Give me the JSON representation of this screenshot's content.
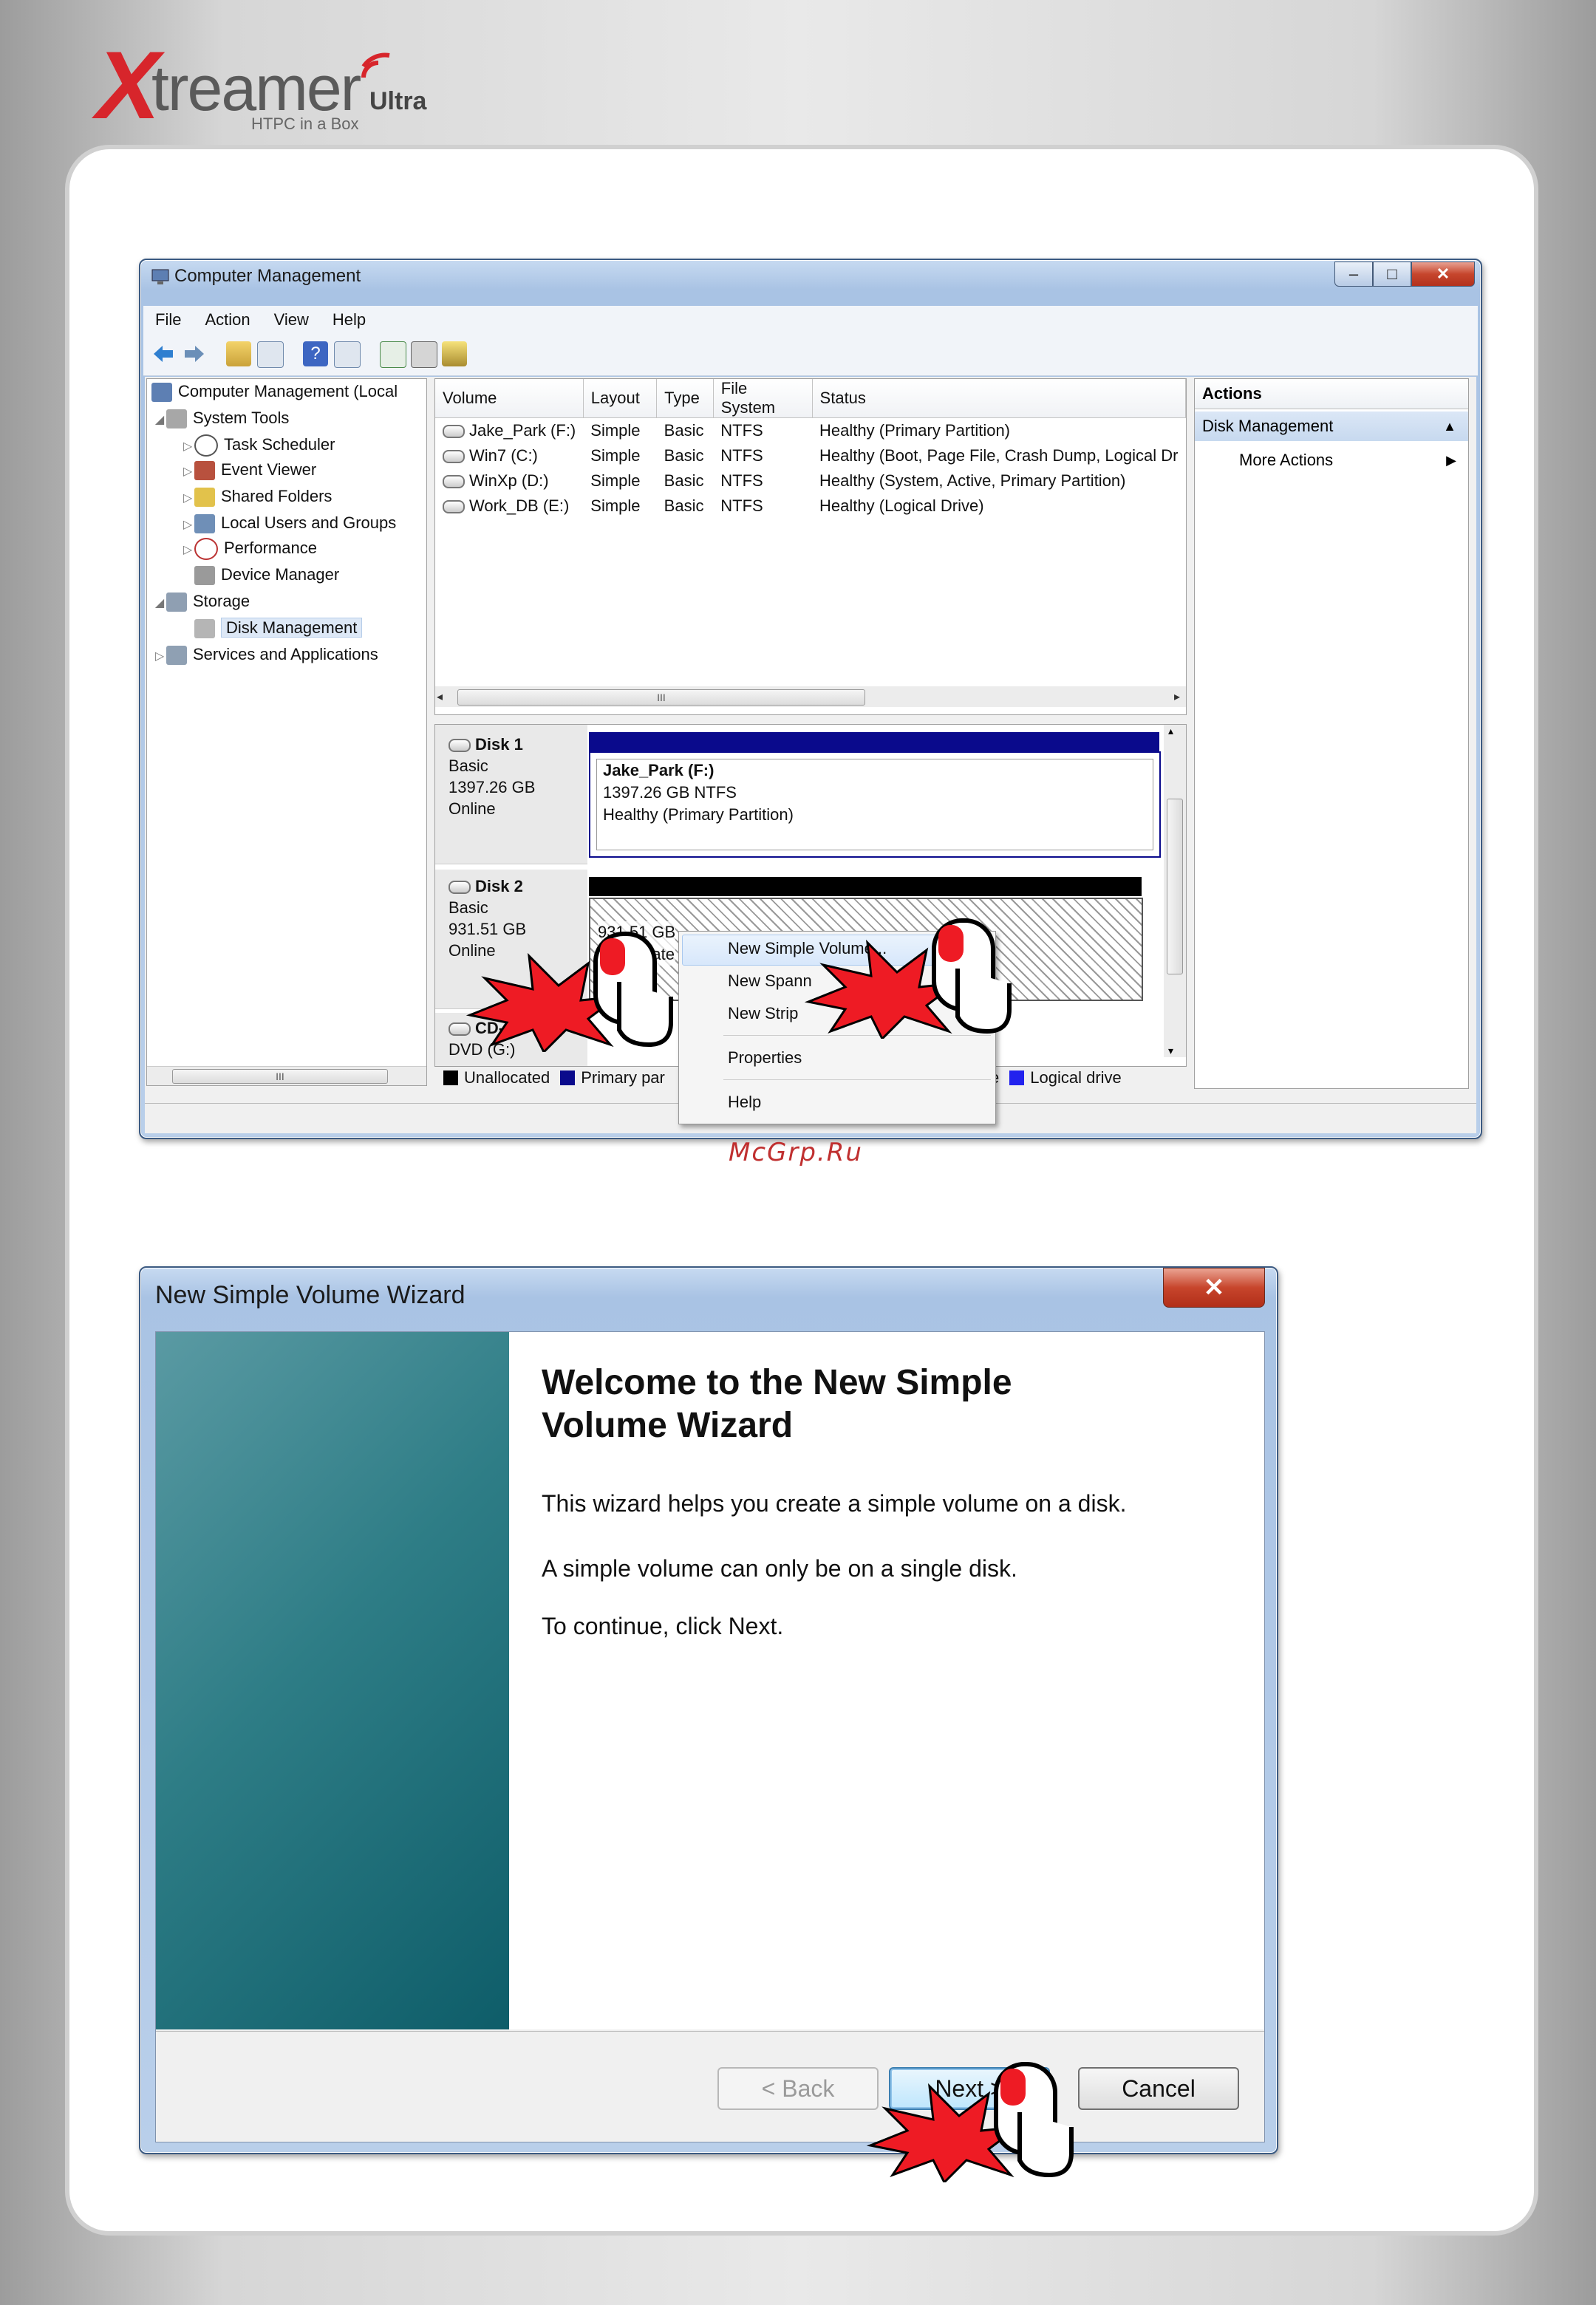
{
  "brand": {
    "mark": "X",
    "word": "treamer",
    "edition": "Ultra",
    "tagline": "HTPC in a Box"
  },
  "watermark": "McGrp.Ru",
  "computer_management": {
    "title": "Computer Management",
    "menu": [
      "File",
      "Action",
      "View",
      "Help"
    ],
    "tree": {
      "root": "Computer Management (Local",
      "system_tools": "System Tools",
      "task_scheduler": "Task Scheduler",
      "event_viewer": "Event Viewer",
      "shared_folders": "Shared Folders",
      "local_users": "Local Users and Groups",
      "performance": "Performance",
      "device_manager": "Device Manager",
      "storage": "Storage",
      "disk_management": "Disk Management",
      "services": "Services and Applications"
    },
    "columns": [
      "Volume",
      "Layout",
      "Type",
      "File System",
      "Status"
    ],
    "volumes": [
      {
        "volume": "Jake_Park (F:)",
        "layout": "Simple",
        "type": "Basic",
        "fs": "NTFS",
        "status": "Healthy (Primary Partition)"
      },
      {
        "volume": "Win7 (C:)",
        "layout": "Simple",
        "type": "Basic",
        "fs": "NTFS",
        "status": "Healthy (Boot, Page File, Crash Dump, Logical Dr"
      },
      {
        "volume": "WinXp (D:)",
        "layout": "Simple",
        "type": "Basic",
        "fs": "NTFS",
        "status": "Healthy (System, Active, Primary Partition)"
      },
      {
        "volume": "Work_DB (E:)",
        "layout": "Simple",
        "type": "Basic",
        "fs": "NTFS",
        "status": "Healthy (Logical Drive)"
      }
    ],
    "disk1": {
      "name": "Disk 1",
      "type": "Basic",
      "size": "1397.26 GB",
      "state": "Online",
      "vol_name": "Jake_Park  (F:)",
      "vol_size": "1397.26 GB NTFS",
      "vol_status": "Healthy (Primary Partition)"
    },
    "disk2": {
      "name": "Disk 2",
      "type": "Basic",
      "size": "931.51 GB",
      "state": "Online",
      "vol_size": "931.51 GB",
      "vol_status": "Unallocate"
    },
    "cdrom": {
      "name": "CD-R",
      "type": "DVD (G:)"
    },
    "legend": {
      "unallocated": "Unallocated",
      "primary": "Primary par",
      "logical_partial": "e",
      "logical": "Logical drive"
    },
    "context_menu": [
      "New Simple Volume...",
      "New Spann",
      "New Strip",
      "Properties",
      "Help"
    ],
    "actions": {
      "header": "Actions",
      "section": "Disk Management",
      "more": "More Actions"
    },
    "scroll_glyph": "III"
  },
  "wizard": {
    "title": "New Simple Volume Wizard",
    "heading": "Welcome to the New Simple Volume Wizard",
    "p1": "This wizard helps you create a simple volume on a disk.",
    "p2": "A simple volume can only be on a single disk.",
    "p3": "To continue, click Next.",
    "back": "< Back",
    "next": "Next >",
    "cancel": "Cancel"
  },
  "colors": {
    "brand_red": "#d7252b",
    "primary_partition": "#0a0a8c",
    "logical_drive": "#2222ee",
    "unallocated": "#000000"
  }
}
